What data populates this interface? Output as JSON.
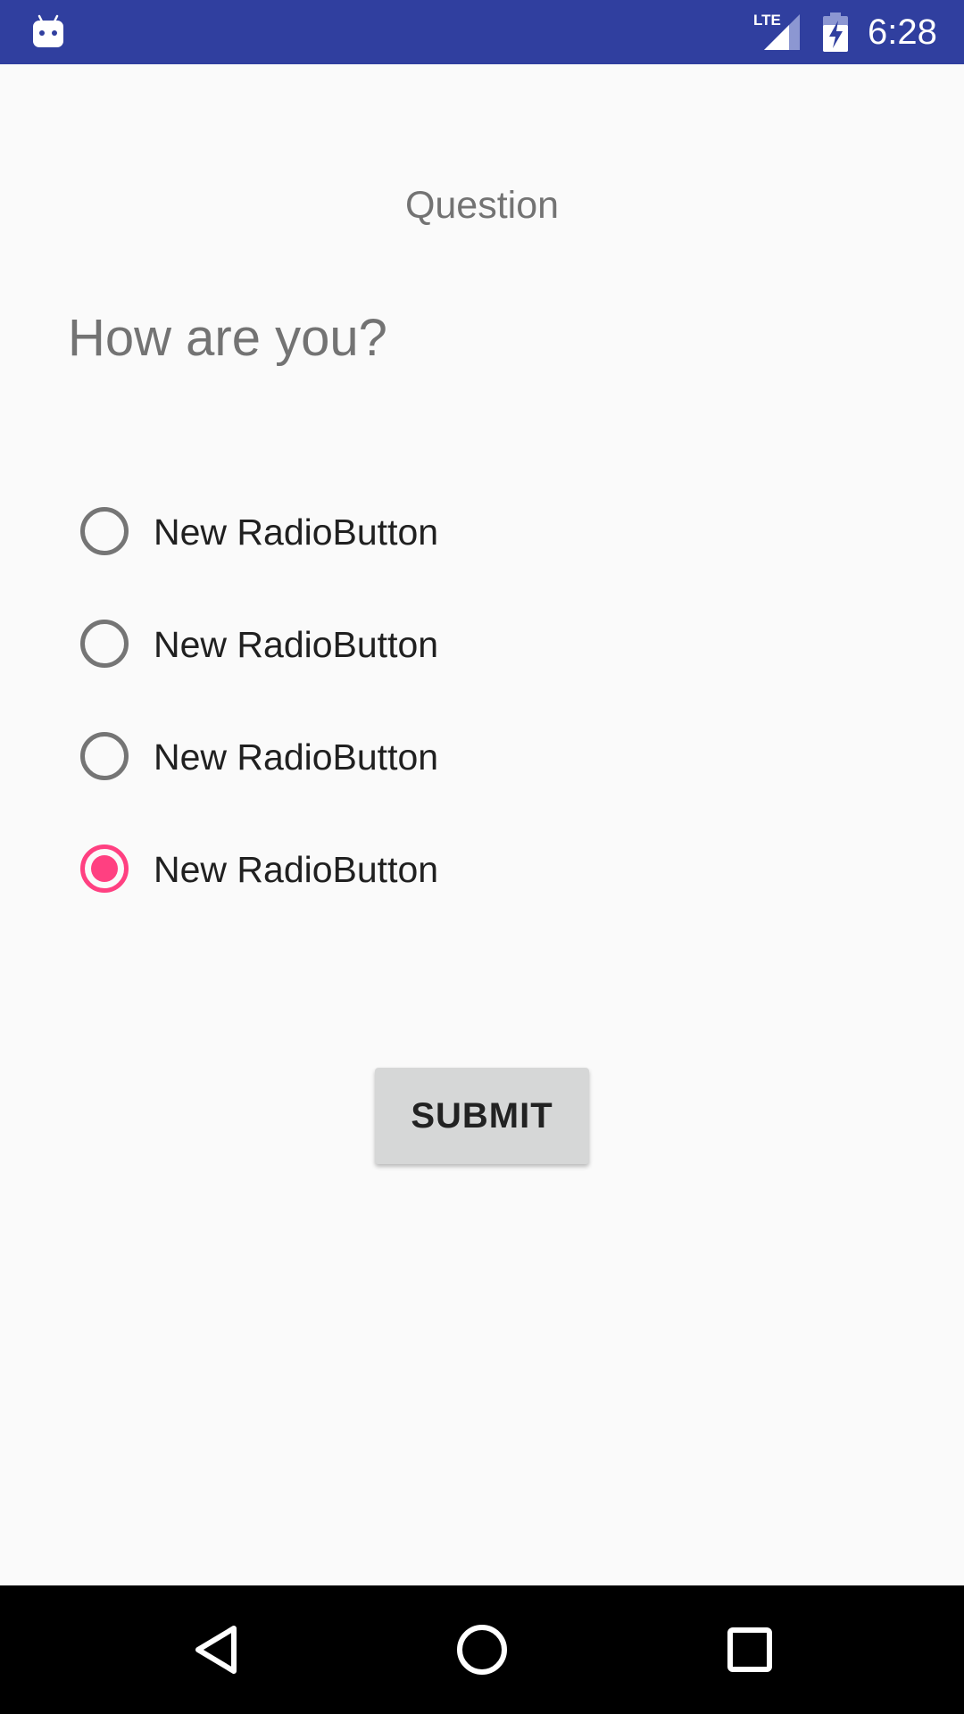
{
  "status_bar": {
    "network_label": "LTE",
    "time": "6:28",
    "app_icon": "android-debug-icon",
    "signal_icon": "cell-signal-icon",
    "battery_icon": "battery-charging-icon",
    "background_color": "#303f9f"
  },
  "screen": {
    "header": "Question",
    "question": "How are you?",
    "options": [
      {
        "label": "New RadioButton",
        "checked": false
      },
      {
        "label": "New RadioButton",
        "checked": false
      },
      {
        "label": "New RadioButton",
        "checked": false
      },
      {
        "label": "New RadioButton",
        "checked": true
      }
    ],
    "submit_label": "SUBMIT",
    "accent_color": "#ff4081"
  },
  "nav_bar": {
    "back_icon": "back-triangle-icon",
    "home_icon": "home-circle-icon",
    "recents_icon": "recents-square-icon"
  }
}
